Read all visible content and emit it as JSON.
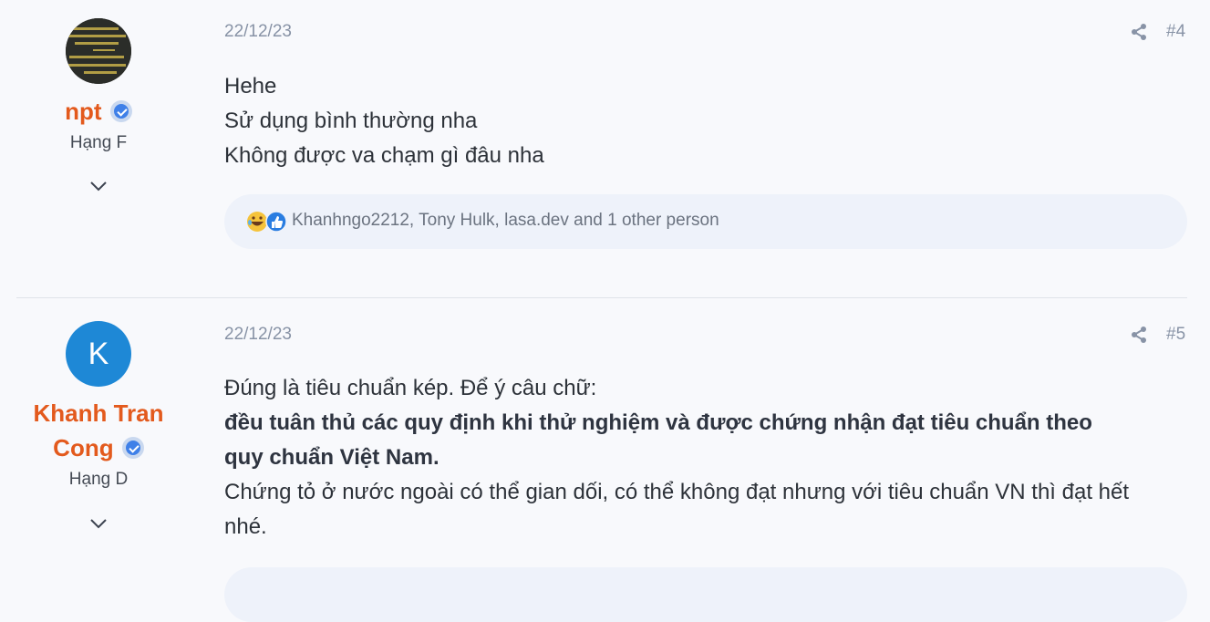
{
  "posts": [
    {
      "user": {
        "name": "npt",
        "rank": "Hạng F",
        "avatar_letter": ""
      },
      "date": "22/12/23",
      "number": "#4",
      "lines": [
        "Hehe",
        "Sử dụng bình thường nha",
        "Không được va chạm gì đâu nha"
      ],
      "reactions": {
        "icons": [
          "laugh-emoji-icon",
          "like-icon"
        ],
        "text": "Khanhngo2212, Tony Hulk, lasa.dev and 1 other person"
      }
    },
    {
      "user": {
        "name": "Khanh Tran Cong",
        "name_line1": "Khanh Tran",
        "name_line2": "Cong",
        "rank": "Hạng D",
        "avatar_letter": "K"
      },
      "date": "22/12/23",
      "number": "#5",
      "line1": "Đúng là tiêu chuẩn kép. Để ý câu chữ:",
      "bold_line1": "đều tuân thủ các quy định khi thử nghiệm và được chứng nhận đạt tiêu chuẩn theo",
      "bold_line2": "quy chuẩn Việt Nam.",
      "line3a": "Chứng tỏ ở nước ngoài có thể gian dối, có thể không đạt nhưng với tiêu chuẩn VN thì đạt hết",
      "line3b": "nhé."
    }
  ],
  "colors": {
    "accent": "#e35a1d",
    "verified": "#3f80e8",
    "meta": "#8893a6"
  }
}
